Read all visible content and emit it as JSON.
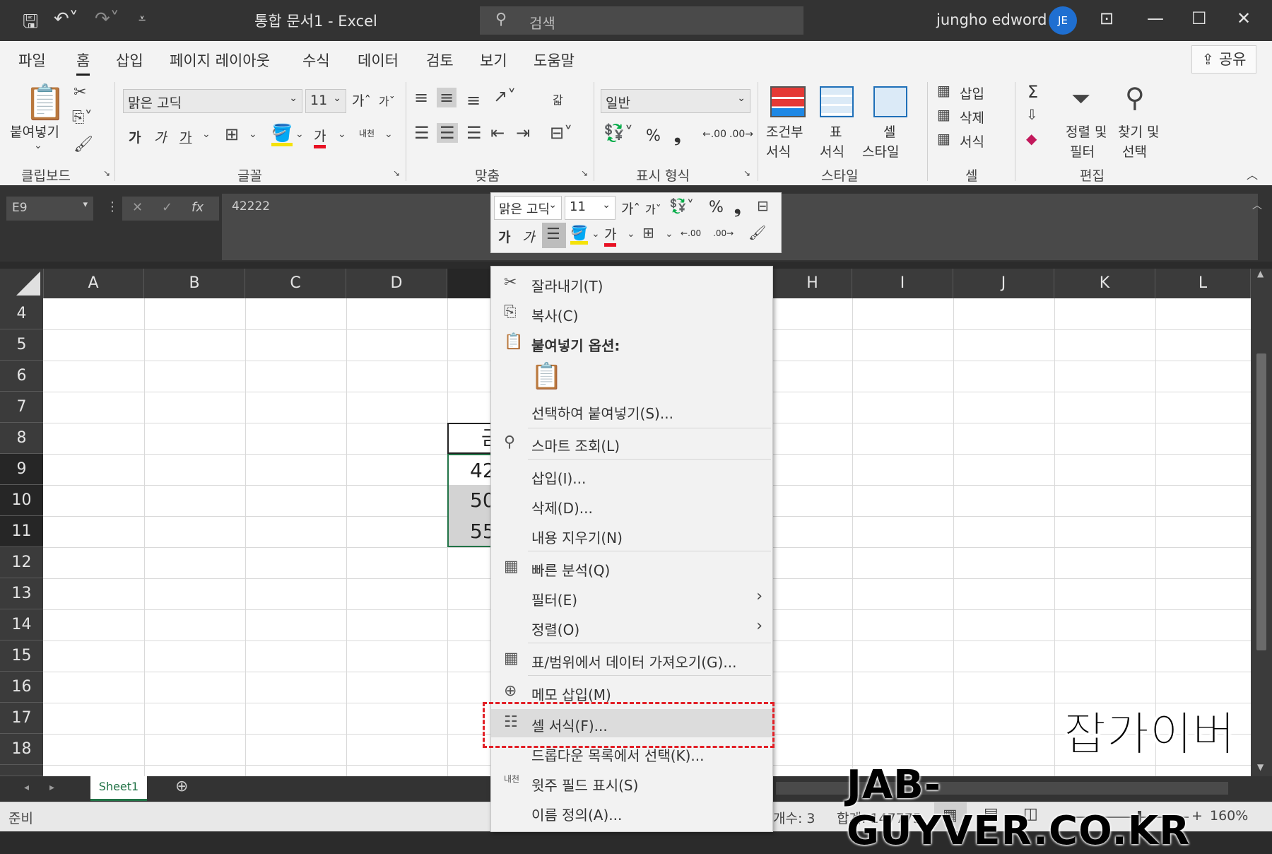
{
  "titlebar": {
    "title": "통합 문서1  -  Excel",
    "search_placeholder": "검색",
    "user_name": "jungho edword",
    "avatar_initials": "JE"
  },
  "tabs": [
    "파일",
    "홈",
    "삽입",
    "페이지 레이아웃",
    "수식",
    "데이터",
    "검토",
    "보기",
    "도움말"
  ],
  "share_label": "공유",
  "ribbon": {
    "clipboard": {
      "paste_label": "붙여넣기",
      "group": "클립보드"
    },
    "font": {
      "font_name": "맑은 고딕",
      "font_size": "11",
      "bold": "가",
      "italic": "가",
      "underline": "가",
      "font_color_glyph": "가",
      "phonetic": "내천",
      "group": "글꼴",
      "grow": "가",
      "shrink": "가"
    },
    "align": {
      "group": "맞춤",
      "wrap": "갋"
    },
    "number": {
      "format": "일반",
      "percent": "%",
      "comma": "❟",
      "group": "표시 형식",
      "inc": ".00",
      "dec": ".00"
    },
    "styles": {
      "cond_line1": "조건부",
      "cond_line2": "서식",
      "table_line1": "표",
      "table_line2": "서식",
      "cell_line1": "셀",
      "cell_line2": "스타일",
      "group": "스타일"
    },
    "cells": {
      "insert": "삽입",
      "delete": "삭제",
      "format": "서식",
      "group": "셀"
    },
    "editing": {
      "sort_line1": "정렬 및",
      "sort_line2": "필터",
      "find_line1": "찾기 및",
      "find_line2": "선택",
      "group": "편집",
      "sigma": "Σ"
    }
  },
  "formula_bar": {
    "name_box": "E9",
    "cancel": "✕",
    "enter": "✓",
    "fx": "fx",
    "content": "42222"
  },
  "columns": [
    "A",
    "B",
    "C",
    "D",
    "",
    "H",
    "I",
    "J",
    "K",
    "L"
  ],
  "rows": [
    "4",
    "5",
    "6",
    "7",
    "8",
    "9",
    "10",
    "11",
    "12",
    "13",
    "14",
    "15",
    "16",
    "17",
    "18"
  ],
  "cells": {
    "e8": "금",
    "e9": "42",
    "e10": "50",
    "e11": "55"
  },
  "mini_toolbar": {
    "font_name": "맑은 고딕",
    "font_size": "11",
    "bold": "가",
    "italic": "가",
    "font_color": "가",
    "percent": "%",
    "comma": "❟",
    "grow": "가",
    "shrink": "가",
    "inc": ".00",
    "dec": ".00"
  },
  "context_menu": {
    "cut": "잘라내기(T)",
    "copy": "복사(C)",
    "paste_options": "붙여넣기 옵션:",
    "paste_special": "선택하여 붙여넣기(S)...",
    "smart_lookup": "스마트 조회(L)",
    "insert": "삽입(I)...",
    "delete": "삭제(D)...",
    "clear": "내용 지우기(N)",
    "quick_analysis": "빠른 분석(Q)",
    "filter": "필터(E)",
    "sort": "정렬(O)",
    "get_data": "표/범위에서 데이터 가져오기(G)...",
    "insert_comment": "메모 삽입(M)",
    "format_cells": "셀 서식(F)...",
    "dropdown": "드롭다운 목록에서 선택(K)...",
    "phonetic": "윗주 필드 표시(S)",
    "define_name": "이름 정의(A)..."
  },
  "sheet_tab": "Sheet1",
  "status": {
    "ready": "준비",
    "count": "개수: 3",
    "sum": "합계: 147775",
    "zoom": "160%"
  },
  "watermark": {
    "line1": "잡가이버",
    "line2": "JAB-GUYVER.CO.KR"
  },
  "colors": {
    "accent_green": "#217346",
    "highlight_red": "#e21f26",
    "avatar_blue": "#1f6fd1"
  }
}
